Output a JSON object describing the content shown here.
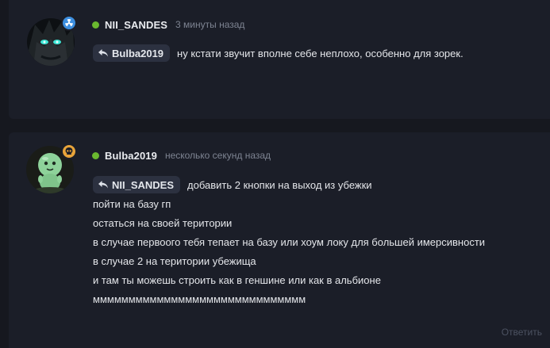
{
  "comments": [
    {
      "author": "NII_SANDES",
      "time": "3 минуты назад",
      "reply_to": "Bulba2019",
      "text": "ну кстати звучит вполне себе неплохо, особенно для зорек."
    },
    {
      "author": "Bulba2019",
      "time": "несколько секунд назад",
      "reply_to": "NII_SANDES",
      "lines": [
        "добавить 2 кнопки на выход из убежки",
        "пойти на базу гп",
        "остаться на своей територии",
        "в случае первоого тебя тепает на базу или хоум локу для большей имерсивности",
        "в случае 2 на територии убежища",
        "и там ты можешь строить как в геншине или как в альбионе",
        "мммммммммммммммммммммммммммммм"
      ],
      "reply_action": "Ответить"
    }
  ],
  "colors": {
    "online": "#6ab82f",
    "badge_radiation": "#3d8fe0",
    "badge_skull": "#e8a43a"
  },
  "icons": [
    "radiation-icon",
    "skull-icon",
    "reply-arrow-icon"
  ]
}
